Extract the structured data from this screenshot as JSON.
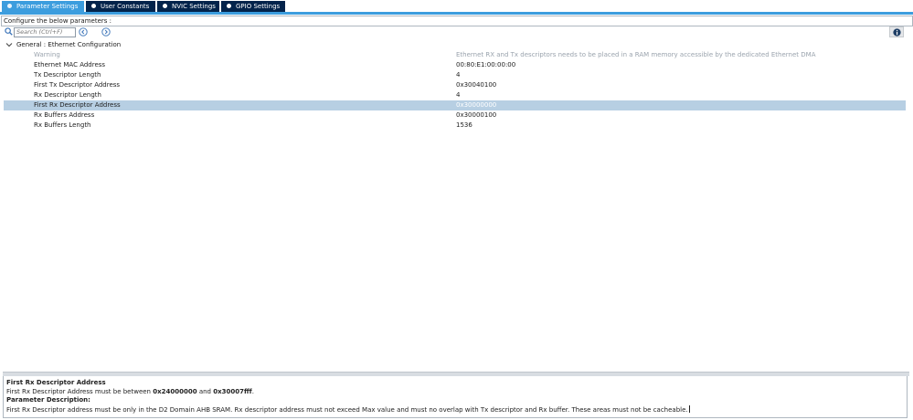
{
  "tabs": [
    {
      "label": "Parameter Settings",
      "active": true
    },
    {
      "label": "User Constants",
      "active": false
    },
    {
      "label": "NVIC Settings",
      "active": false
    },
    {
      "label": "GPIO Settings",
      "active": false
    }
  ],
  "config_label": "Configure the below parameters :",
  "search": {
    "placeholder": "Search (Ctrl+F)",
    "value": ""
  },
  "group": {
    "label": "General : Ethernet Configuration",
    "expanded": true
  },
  "params": [
    {
      "name": "Warning",
      "value": "Ethernet RX and Tx descriptors needs to be placed in a RAM memory accessible by the dedicated Ethernet DMA",
      "state": "disabled"
    },
    {
      "name": "Ethernet MAC Address",
      "value": "00:80:E1:00:00:00",
      "state": "normal"
    },
    {
      "name": "Tx Descriptor Length",
      "value": "4",
      "state": "normal"
    },
    {
      "name": "First Tx Descriptor Address",
      "value": "0x30040100",
      "state": "normal"
    },
    {
      "name": "Rx Descriptor Length",
      "value": "4",
      "state": "normal"
    },
    {
      "name": "First Rx Descriptor Address",
      "value": "0x30000000",
      "state": "selected"
    },
    {
      "name": "Rx Buffers Address",
      "value": "0x30000100",
      "state": "normal"
    },
    {
      "name": "Rx Buffers Length",
      "value": "1536",
      "state": "normal"
    }
  ],
  "description": {
    "title": "First Rx Descriptor Address",
    "line1_prefix": "First Rx Descriptor Address must be between ",
    "line1_min": "0x24000000",
    "line1_mid": " and ",
    "line1_max": "0x30007fff",
    "line1_suffix": ".",
    "param_heading": "Parameter Description:",
    "param_text": "First Rx Descriptor address must be only in the D2 Domain AHB SRAM. Rx descriptor address must not exceed Max value and must no overlap with Tx descriptor and Rx buffer. These areas must not be cacheable."
  },
  "colors": {
    "tab_active": "#3c9dde",
    "tab_inactive": "#03234b",
    "selected_row": "#b7cfe3",
    "disabled_text": "#9aa3ad"
  },
  "icons": [
    "search-icon",
    "previous-icon",
    "next-icon",
    "info-icon",
    "chevron-down-icon"
  ]
}
